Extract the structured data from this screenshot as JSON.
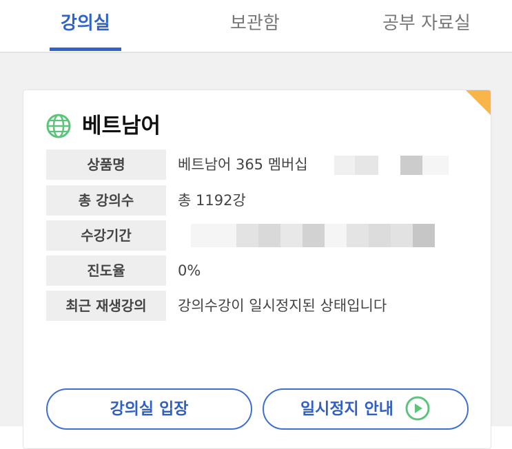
{
  "tabs": [
    {
      "label": "강의실",
      "active": true
    },
    {
      "label": "보관함",
      "active": false
    },
    {
      "label": "공부 자료실",
      "active": false
    }
  ],
  "course": {
    "icon": "globe-icon",
    "title": "베트남어",
    "rows": [
      {
        "label": "상품명",
        "value": "베트남어 365 멤버십"
      },
      {
        "label": "총 강의수",
        "value": "총 1192강"
      },
      {
        "label": "수강기간",
        "value": ""
      },
      {
        "label": "진도율",
        "value": "0%"
      },
      {
        "label": "최근 재생강의",
        "value": "강의수강이 일시정지된 상태입니다"
      }
    ]
  },
  "buttons": {
    "enter_label": "강의실 입장",
    "pause_info_label": "일시정지 안내"
  },
  "colors": {
    "accent": "#2f63c9",
    "corner": "#f9b44a",
    "globe": "#5cc47a"
  }
}
